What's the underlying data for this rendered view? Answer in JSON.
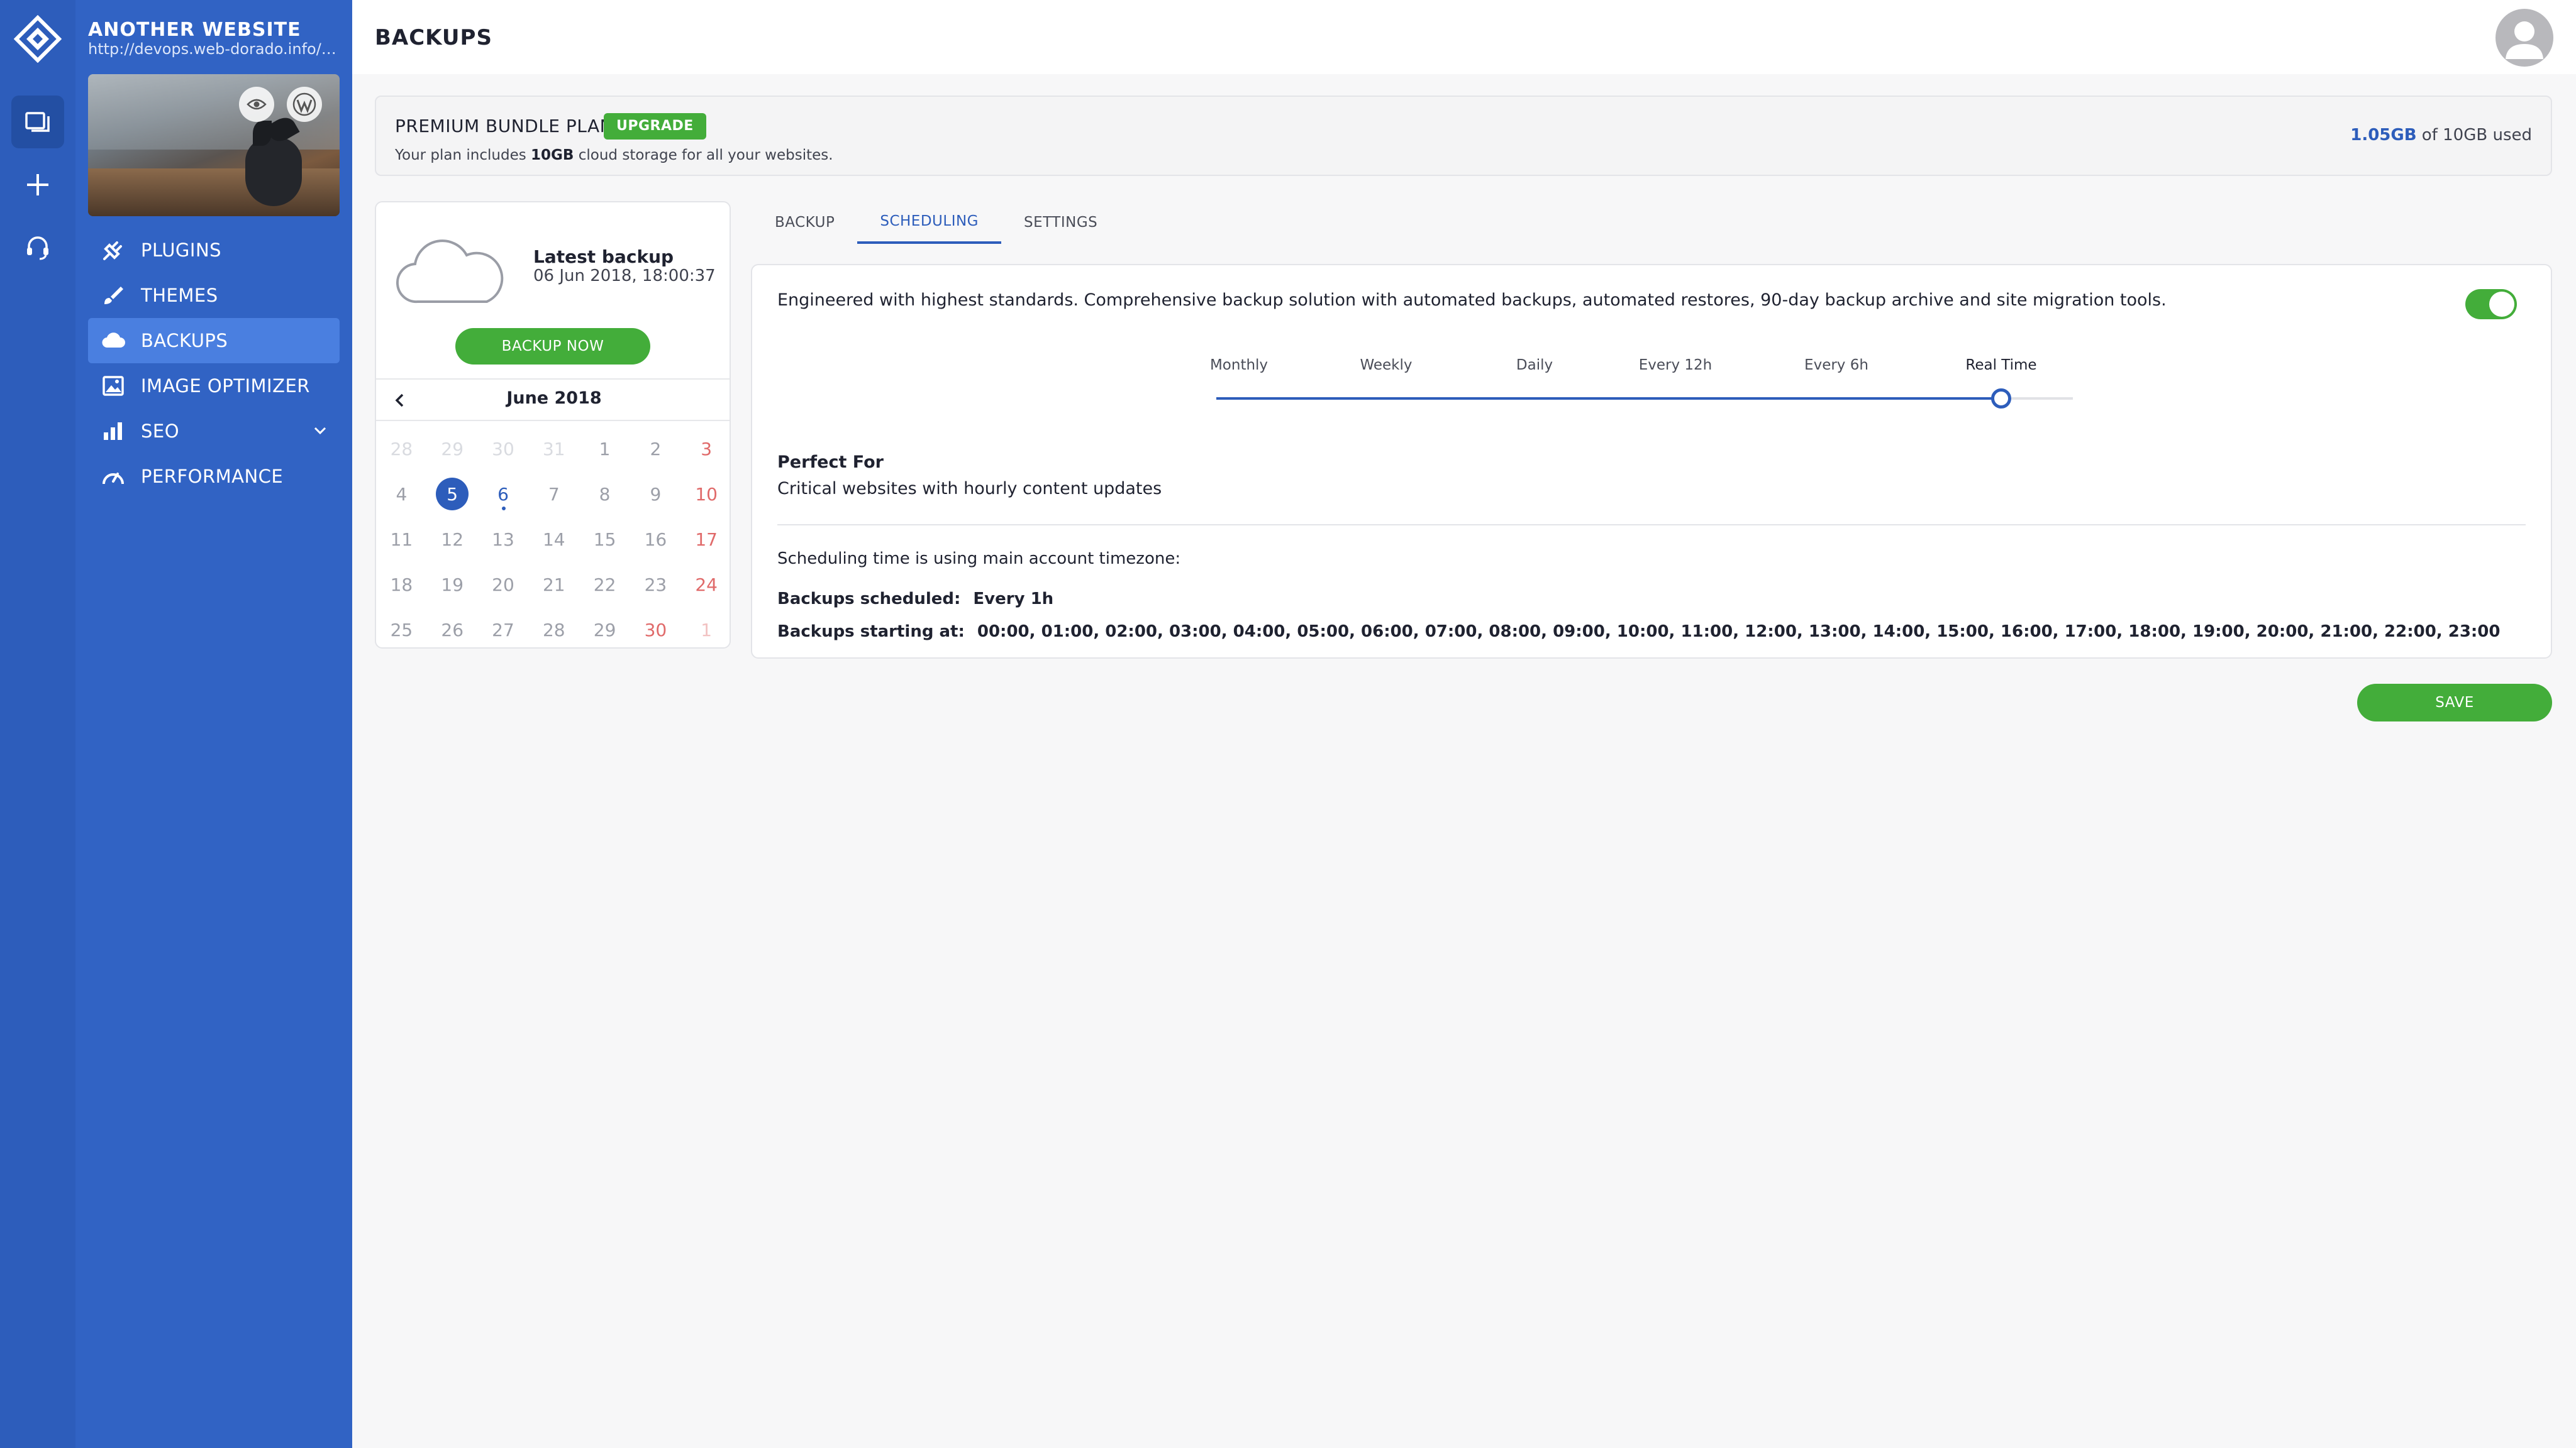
{
  "rail": {
    "icons": [
      "logo-icon",
      "websites-icon",
      "add-icon",
      "support-icon"
    ]
  },
  "site": {
    "name": "ANOTHER WEBSITE",
    "url": "http://devops.web-dorado.info/Na..."
  },
  "nav": {
    "items": [
      {
        "label": "PLUGINS",
        "icon": "plug-icon"
      },
      {
        "label": "THEMES",
        "icon": "brush-icon"
      },
      {
        "label": "BACKUPS",
        "icon": "cloud-icon",
        "active": true
      },
      {
        "label": "IMAGE OPTIMIZER",
        "icon": "image-icon"
      },
      {
        "label": "SEO",
        "icon": "bar-chart-icon",
        "has_submenu": true
      },
      {
        "label": "PERFORMANCE",
        "icon": "speedometer-icon"
      }
    ]
  },
  "header": {
    "title": "BACKUPS"
  },
  "plan": {
    "name": "PREMIUM BUNDLE PLAN",
    "upgrade_label": "UPGRADE",
    "desc_prefix": "Your plan includes ",
    "desc_amount": "10GB",
    "desc_suffix": " cloud storage for all your websites.",
    "usage_used": "1.05GB",
    "usage_rest": " of 10GB used"
  },
  "latest_backup": {
    "title": "Latest backup",
    "date": "06 Jun 2018, 18:00:37",
    "button_label": "BACKUP NOW"
  },
  "calendar": {
    "month_label": "June 2018",
    "weeks": [
      [
        {
          "d": "28",
          "m": true
        },
        {
          "d": "29",
          "m": true
        },
        {
          "d": "30",
          "m": true
        },
        {
          "d": "31",
          "m": true
        },
        {
          "d": "1"
        },
        {
          "d": "2"
        },
        {
          "d": "3",
          "r": true
        }
      ],
      [
        {
          "d": "4"
        },
        {
          "d": "5",
          "sel": true
        },
        {
          "d": "6",
          "bk": true
        },
        {
          "d": "7"
        },
        {
          "d": "8"
        },
        {
          "d": "9"
        },
        {
          "d": "10",
          "r": true
        }
      ],
      [
        {
          "d": "11"
        },
        {
          "d": "12"
        },
        {
          "d": "13"
        },
        {
          "d": "14"
        },
        {
          "d": "15"
        },
        {
          "d": "16"
        },
        {
          "d": "17",
          "r": true
        }
      ],
      [
        {
          "d": "18"
        },
        {
          "d": "19"
        },
        {
          "d": "20"
        },
        {
          "d": "21"
        },
        {
          "d": "22"
        },
        {
          "d": "23"
        },
        {
          "d": "24",
          "r": true
        }
      ],
      [
        {
          "d": "25"
        },
        {
          "d": "26"
        },
        {
          "d": "27"
        },
        {
          "d": "28"
        },
        {
          "d": "29"
        },
        {
          "d": "30",
          "r": true
        },
        {
          "d": "1",
          "m": true,
          "r": true
        }
      ]
    ]
  },
  "tabs": [
    {
      "label": "BACKUP"
    },
    {
      "label": "SCHEDULING",
      "active": true
    },
    {
      "label": "SETTINGS"
    }
  ],
  "scheduling": {
    "description": "Engineered with highest standards. Comprehensive backup solution with automated backups, automated restores, 90-day backup archive and site migration tools.",
    "enabled": true,
    "frequencies": [
      "Monthly",
      "Weekly",
      "Daily",
      "Every 12h",
      "Every 6h",
      "Real Time"
    ],
    "selected_index": 5,
    "perfect_for_title": "Perfect For",
    "perfect_for_text": "Critical websites with hourly content updates",
    "timezone_note": "Scheduling time is using main account timezone:",
    "scheduled_label": "Backups scheduled:",
    "scheduled_value": "Every 1h",
    "starting_label": "Backups starting at:",
    "starting_value": "00:00, 01:00, 02:00, 03:00, 04:00, 05:00, 06:00, 07:00, 08:00, 09:00, 10:00, 11:00, 12:00, 13:00, 14:00, 15:00, 16:00, 17:00, 18:00, 19:00, 20:00, 21:00, 22:00, 23:00"
  },
  "save_label": "SAVE",
  "colors": {
    "rail": "#2d5dbb",
    "sidebar": "#3163c4",
    "accent": "#2d5dbb",
    "green": "#43ad3a"
  }
}
